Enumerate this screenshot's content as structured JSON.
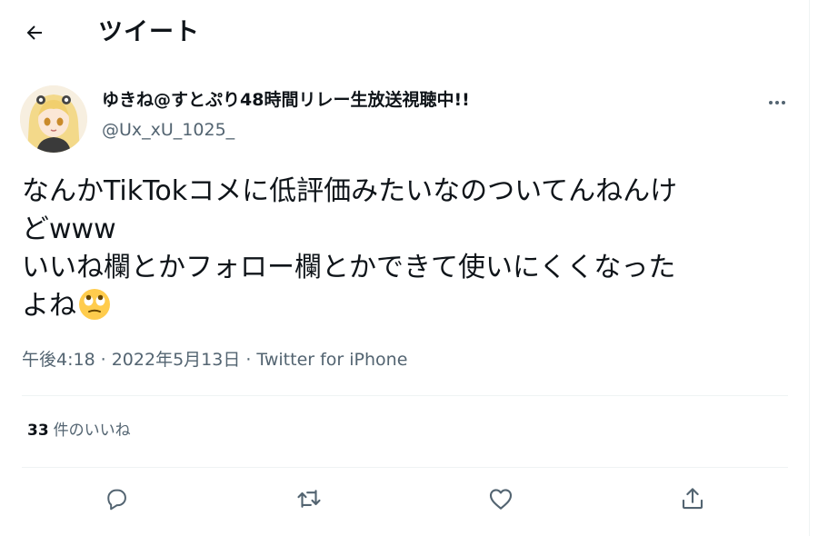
{
  "header": {
    "title": "ツイート"
  },
  "user": {
    "display_name": "ゆきね@すとぷり48時間リレー生放送視聴中!!",
    "handle": "@Ux_xU_1025_"
  },
  "tweet": {
    "lines": [
      "なんかTikTokコメに低評価みたいなのついてんねんけ",
      "どwww",
      "いいね欄とかフォロー欄とかできて使いにくくなった",
      "よね"
    ],
    "emoji": "face-with-rolling-eyes"
  },
  "meta": {
    "time": "午後4:18",
    "separator": "·",
    "date": "2022年5月13日",
    "source": "Twitter for iPhone"
  },
  "stats": {
    "likes_count": "33",
    "likes_label": "件のいいね"
  },
  "icons": [
    "back-arrow-icon",
    "more-icon",
    "reply-icon",
    "retweet-icon",
    "like-icon",
    "share-icon"
  ],
  "colors": {
    "text": "#0f1419",
    "secondary": "#536471",
    "border": "#eff3f4"
  }
}
